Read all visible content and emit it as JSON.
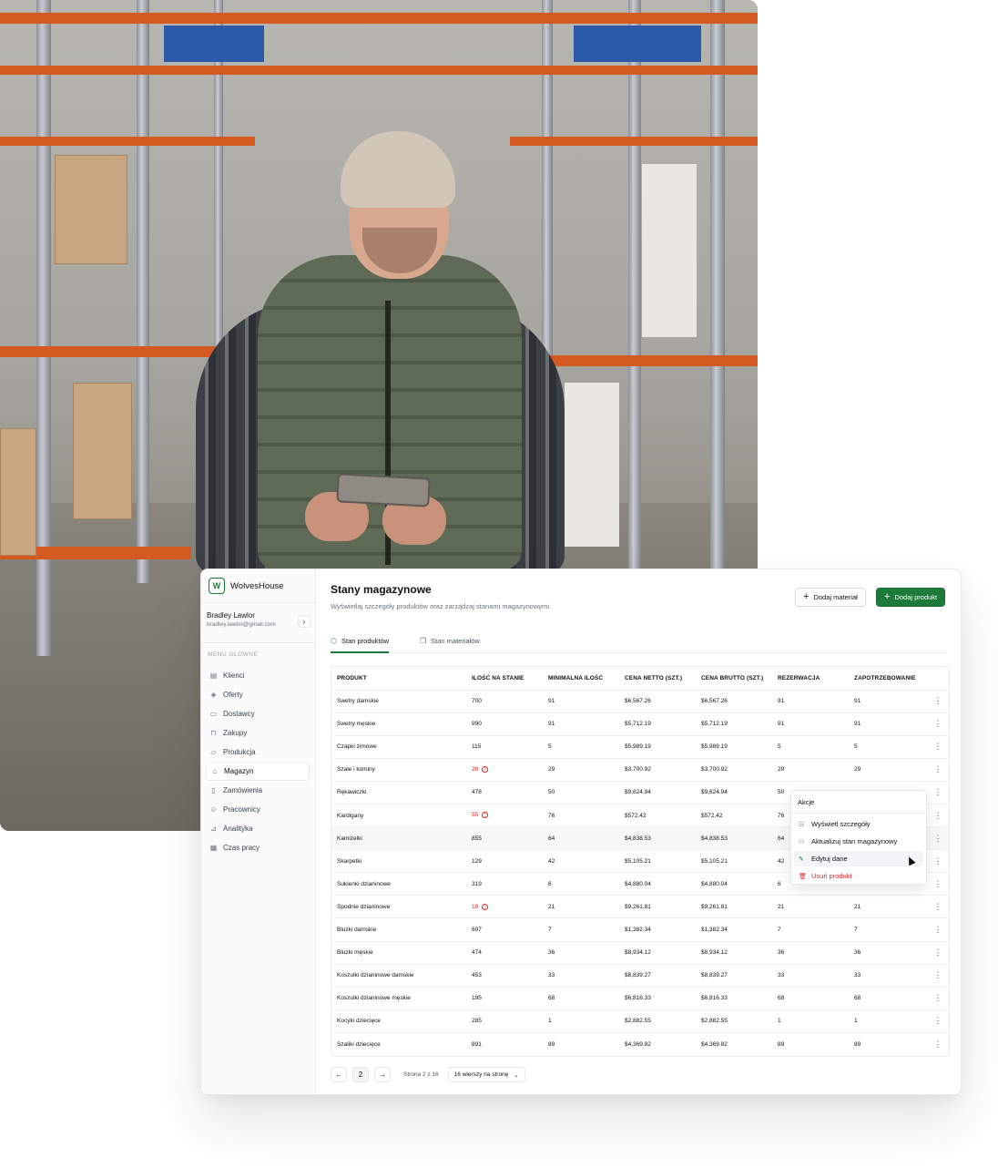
{
  "colors": {
    "accent": "#1e7a3a",
    "danger": "#dc2626",
    "muted": "#6b7280"
  },
  "sidebar": {
    "brand": "WolvesHouse",
    "user": {
      "name": "Bradley Lawlor",
      "email": "bradley.lawlor@gmail.com"
    },
    "menu_heading": "MENU GŁÓWNE",
    "items": [
      {
        "label": "Klienci",
        "icon": "clients-icon"
      },
      {
        "label": "Oferty",
        "icon": "offers-icon"
      },
      {
        "label": "Dostawcy",
        "icon": "truck-icon"
      },
      {
        "label": "Zakupy",
        "icon": "cart-icon"
      },
      {
        "label": "Produkcja",
        "icon": "production-icon"
      },
      {
        "label": "Magazyn",
        "icon": "warehouse-icon",
        "active": true
      },
      {
        "label": "Zamówienia",
        "icon": "orders-icon"
      },
      {
        "label": "Pracownicy",
        "icon": "employees-icon"
      },
      {
        "label": "Analityka",
        "icon": "analytics-icon"
      },
      {
        "label": "Czas pracy",
        "icon": "calendar-icon"
      }
    ]
  },
  "header": {
    "title": "Stany magazynowe",
    "subtitle": "Wyświetlaj szczegóły produktów oraz zarządzaj stanami magazynowymi.",
    "add_material": "Dodaj materiał",
    "add_product": "Dodaj produkt"
  },
  "tabs": [
    {
      "label": "Stan produktów",
      "active": true
    },
    {
      "label": "Stan materiałów",
      "active": false
    }
  ],
  "table": {
    "columns": [
      "PRODUKT",
      "ILOŚĆ NA STANIE",
      "MINIMALNA ILOŚĆ",
      "CENA NETTO (SZT.)",
      "CENA BRUTTO (SZT.)",
      "REZERWACJA",
      "ZAPOTRZEBOWANIE"
    ],
    "rows": [
      {
        "name": "Swetry damskie",
        "qty": "700",
        "low": false,
        "min": "91",
        "net": "$6,567.26",
        "gross": "$6,567.26",
        "res": "91",
        "dem": "91"
      },
      {
        "name": "Swetry męskie",
        "qty": "990",
        "low": false,
        "min": "91",
        "net": "$5,712.19",
        "gross": "$5,712.19",
        "res": "91",
        "dem": "91"
      },
      {
        "name": "Czapki zimowe",
        "qty": "115",
        "low": false,
        "min": "5",
        "net": "$5,989.19",
        "gross": "$5,989.19",
        "res": "5",
        "dem": "5"
      },
      {
        "name": "Szale i kominy",
        "qty": "28",
        "low": true,
        "min": "29",
        "net": "$3,700.92",
        "gross": "$3,700.92",
        "res": "29",
        "dem": "29"
      },
      {
        "name": "Rękawiczki",
        "qty": "478",
        "low": false,
        "min": "50",
        "net": "$9,624.94",
        "gross": "$9,624.94",
        "res": "50",
        "dem": ""
      },
      {
        "name": "Kardigany",
        "qty": "55",
        "low": true,
        "min": "76",
        "net": "$572.42",
        "gross": "$572.42",
        "res": "76",
        "dem": ""
      },
      {
        "name": "Kamizelki",
        "qty": "855",
        "low": false,
        "min": "64",
        "net": "$4,838.53",
        "gross": "$4,838.53",
        "res": "64",
        "dem": "",
        "highlight": true
      },
      {
        "name": "Skarpetki",
        "qty": "129",
        "low": false,
        "min": "42",
        "net": "$5,105.21",
        "gross": "$5,105.21",
        "res": "42",
        "dem": ""
      },
      {
        "name": "Sukienki dzianinowe",
        "qty": "319",
        "low": false,
        "min": "6",
        "net": "$4,880.04",
        "gross": "$4,880.04",
        "res": "6",
        "dem": ""
      },
      {
        "name": "Spodnie dzianinowe",
        "qty": "19",
        "low": true,
        "min": "21",
        "net": "$9,261.81",
        "gross": "$9,261.81",
        "res": "21",
        "dem": "21"
      },
      {
        "name": "Bluzki damskie",
        "qty": "697",
        "low": false,
        "min": "7",
        "net": "$1,382.34",
        "gross": "$1,382.34",
        "res": "7",
        "dem": "7"
      },
      {
        "name": "Bluzki męskie",
        "qty": "474",
        "low": false,
        "min": "36",
        "net": "$8,934.12",
        "gross": "$8,934.12",
        "res": "36",
        "dem": "36"
      },
      {
        "name": "Koszulki dzianinowe damskie",
        "qty": "453",
        "low": false,
        "min": "33",
        "net": "$8,839.27",
        "gross": "$8,839.27",
        "res": "33",
        "dem": "33"
      },
      {
        "name": "Koszulki dzianinowe męskie",
        "qty": "195",
        "low": false,
        "min": "68",
        "net": "$6,816.33",
        "gross": "$6,816.33",
        "res": "68",
        "dem": "68"
      },
      {
        "name": "Kocyki dziecięce",
        "qty": "285",
        "low": false,
        "min": "1",
        "net": "$2,882.55",
        "gross": "$2,882.55",
        "res": "1",
        "dem": "1"
      },
      {
        "name": "Szaliki dziecięce",
        "qty": "891",
        "low": false,
        "min": "89",
        "net": "$4,369.82",
        "gross": "$4,369.82",
        "res": "89",
        "dem": "89"
      }
    ]
  },
  "context_menu": {
    "title": "Akcje",
    "items": [
      {
        "label": "Wyświetl szczegóły",
        "icon": "details-icon"
      },
      {
        "label": "Aktualizuj stan magazynowy",
        "icon": "update-stock-icon"
      },
      {
        "label": "Edytuj dane",
        "icon": "edit-icon"
      },
      {
        "label": "Usuń produkt",
        "icon": "trash-icon"
      }
    ]
  },
  "pagination": {
    "current_page": "2",
    "status": "Strona 2 z 16",
    "per_page": "16 wierszy na stronę"
  }
}
